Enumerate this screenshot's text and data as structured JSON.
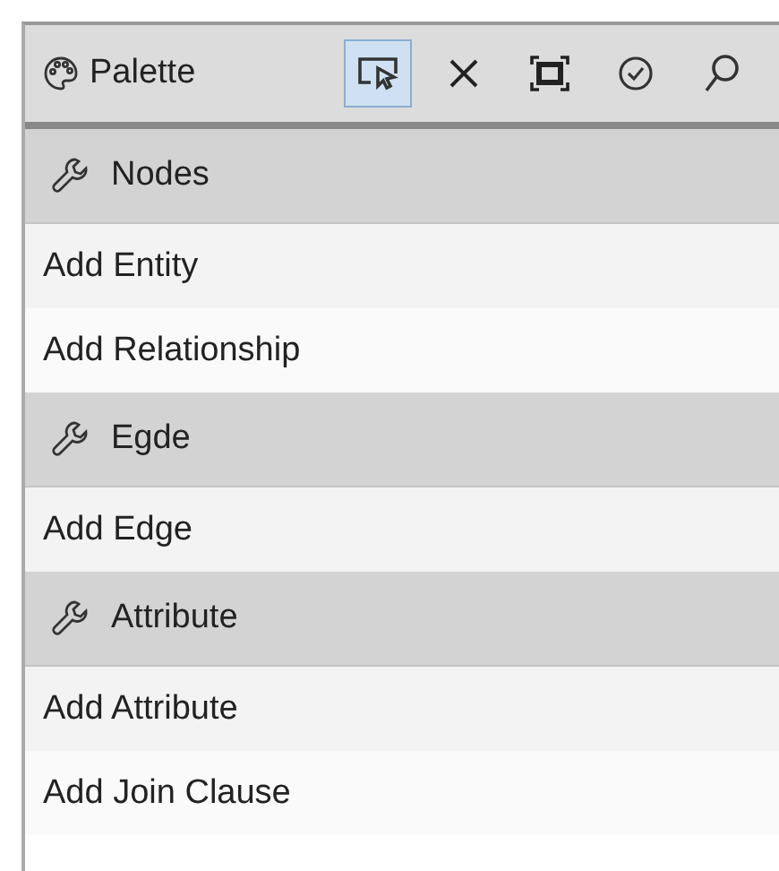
{
  "palette": {
    "title": "Palette",
    "tools": [
      {
        "kind": "select",
        "selected": true
      },
      {
        "kind": "delete",
        "selected": false
      },
      {
        "kind": "fit",
        "selected": false
      },
      {
        "kind": "validate",
        "selected": false
      },
      {
        "kind": "search",
        "selected": false
      }
    ],
    "groups": [
      {
        "label": "Nodes",
        "items": [
          "Add Entity",
          "Add Relationship"
        ]
      },
      {
        "label": "Egde",
        "items": [
          "Add Edge"
        ]
      },
      {
        "label": "Attribute",
        "items": [
          "Add Attribute",
          "Add Join Clause"
        ]
      }
    ]
  }
}
